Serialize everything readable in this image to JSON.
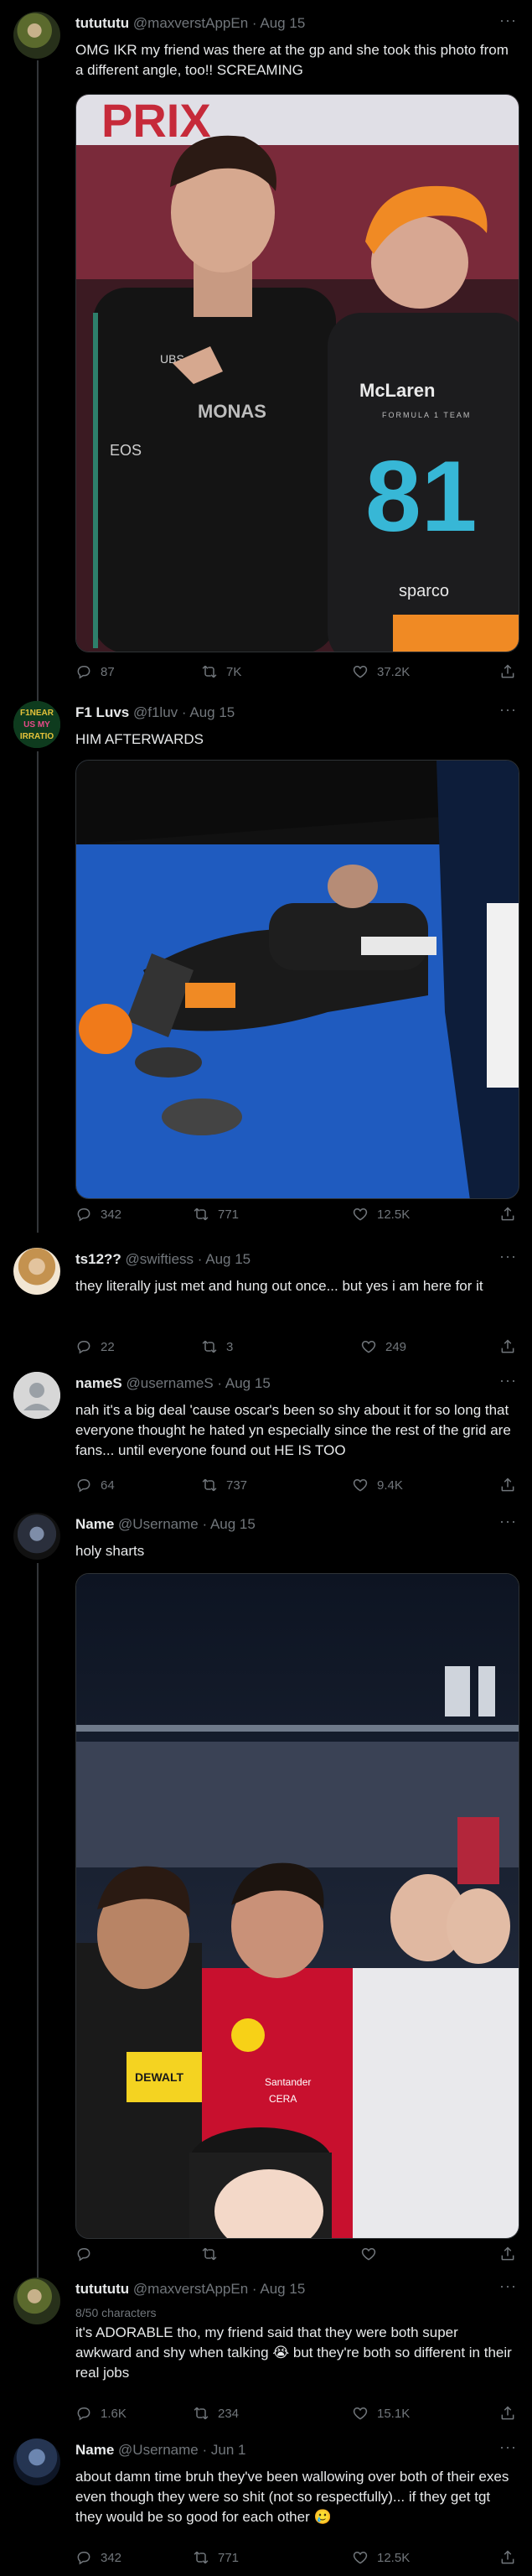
{
  "colors": {
    "bg": "#000000",
    "text": "#e7e9ea",
    "muted": "#71767b",
    "line": "#333639"
  },
  "tweets": [
    {
      "name": "tutututu",
      "handle": "@maxverstAppEn",
      "date": "Aug 15",
      "text": "OMG IKR my friend was there at the gp and she took this photo from a different angle, too!! SCREAMING",
      "image_text": {
        "banner": "PRIX",
        "team": "McLaren",
        "sub": "FORMULA 1 TEAM",
        "number": "81",
        "brand": "sparco",
        "team2": "MONAS",
        "sponsor": "EOS",
        "sponsor2": "UBS"
      },
      "replies": "87",
      "retweets": "7K",
      "likes": "37.2K"
    },
    {
      "name": "F1 Luvs",
      "handle": "@f1luv",
      "date": "Aug 15",
      "text": "HIM AFTERWARDS",
      "replies": "342",
      "retweets": "771",
      "likes": "12.5K"
    },
    {
      "name": "ts12??",
      "handle": "@swiftiess",
      "date": "Aug 15",
      "text": "they literally just met and hung out once... but yes i am here for it",
      "replies": "22",
      "retweets": "3",
      "likes": "249"
    },
    {
      "name": "nameS",
      "handle": "@usernameS",
      "date": "Aug 15",
      "text": "nah it's a big deal 'cause oscar's been so shy about it for so long that everyone thought he hated yn especially since the rest of the grid are fans... until everyone found out HE IS TOO",
      "replies": "64",
      "retweets": "737",
      "likes": "9.4K"
    },
    {
      "name": "Name",
      "handle": "@Username",
      "date": "Aug 15",
      "text": "holy sharts",
      "image_text": {
        "sponsor": "Santander",
        "sponsor2": "DEWALT",
        "sponsor3": "CERA"
      },
      "replies": "",
      "retweets": "",
      "likes": ""
    },
    {
      "name": "tutututu",
      "handle": "@maxverstAppEn",
      "date": "Aug 15",
      "counter": "8/50 characters",
      "text": "it's ADORABLE tho, my friend said that they were both super awkward and shy when talking 😭 but they're both so different in their real jobs",
      "replies": "1.6K",
      "retweets": "234",
      "likes": "15.1K"
    },
    {
      "name": "Name",
      "handle": "@Username",
      "date": "Jun 1",
      "text": "about damn time bruh they've been wallowing over both of their exes even though they were so shit (not so respectfully)... if they get tgt they would be so good for each other 🥲",
      "replies": "342",
      "retweets": "771",
      "likes": "12.5K"
    }
  ],
  "avatar4_header": {
    "line1": "F1NEAR",
    "line2": "US MY",
    "line3": "IRRATIO"
  }
}
